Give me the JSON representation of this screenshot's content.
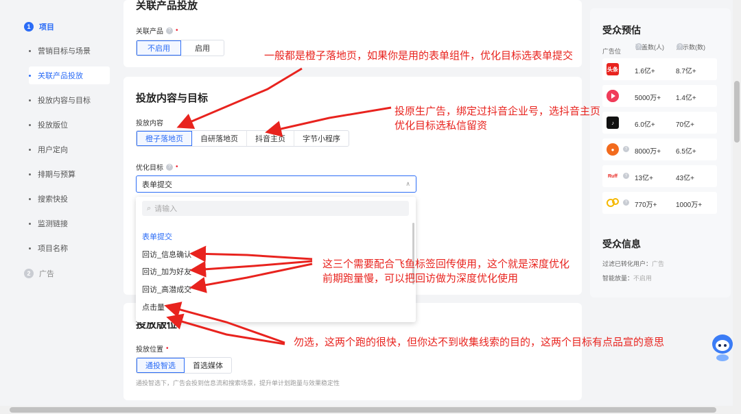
{
  "nav": {
    "steps": [
      {
        "num": "1",
        "label": "项目"
      },
      {
        "num": "2",
        "label": "广告"
      }
    ],
    "items": [
      {
        "label": "营销目标与场景"
      },
      {
        "label": "关联产品投放"
      },
      {
        "label": "投放内容与目标"
      },
      {
        "label": "投放版位"
      },
      {
        "label": "用户定向"
      },
      {
        "label": "排期与预算"
      },
      {
        "label": "搜索快投"
      },
      {
        "label": "监测链接"
      },
      {
        "label": "项目名称"
      }
    ]
  },
  "related": {
    "title": "关联产品投放",
    "label": "关联产品",
    "options": [
      "不启用",
      "启用"
    ]
  },
  "content": {
    "title": "投放内容与目标",
    "content_label": "投放内容",
    "content_options": [
      "橙子落地页",
      "自研落地页",
      "抖音主页",
      "字节小程序"
    ],
    "goal_label": "优化目标",
    "goal_value": "表单提交"
  },
  "dropdown": {
    "placeholder": "请输入",
    "items": [
      "表单提交",
      "回访_信息确认",
      "回访_加为好友",
      "回访_高潜成交",
      "点击量"
    ]
  },
  "placement": {
    "title": "投放版位",
    "label": "投放位置",
    "options": [
      "通投智选",
      "首选媒体"
    ],
    "hint": "通投智选下，广告会投到信息流和搜索场景，提升单计划跑量与效果稳定性"
  },
  "audience": {
    "title": "受众预估",
    "col_position": "广告位",
    "col_coverage": "覆盖数(人)",
    "col_impressions": "展示数(数)",
    "rows": [
      {
        "logo": "头条",
        "coverage": "1.6亿+",
        "impressions": "8.7亿+"
      },
      {
        "logo": "西瓜",
        "coverage": "5000万+",
        "impressions": "1.4亿+"
      },
      {
        "logo": "抖音",
        "coverage": "6.0亿+",
        "impressions": "70亿+"
      },
      {
        "logo": "番茄",
        "coverage": "8000万+",
        "impressions": "6.5亿+"
      },
      {
        "logo": "Ruff",
        "coverage": "13亿+",
        "impressions": "43亿+"
      },
      {
        "logo": "金币",
        "coverage": "770万+",
        "impressions": "1000万+"
      }
    ]
  },
  "audience_info": {
    "title": "受众信息",
    "filter_label": "过滤已转化用户：",
    "filter_value": "广告",
    "smart_label": "智能放量：",
    "smart_value": "不启用"
  },
  "annotations": {
    "a1": "一般都是橙子落地页，如果你是用的表单组件，优化目标选表单提交",
    "a2_line1": "投原生广告，绑定过抖音企业号，选抖音主页",
    "a2_line2": "优化目标选私信留资",
    "a3_line1": "这三个需要配合飞鱼标签回传使用，这个就是深度优化",
    "a3_line2": "前期跑量慢，可以把回访做为深度优化使用",
    "a4": "勿选，这两个跑的很快，但你达不到收集线索的目的，这两个目标有点品宣的意思"
  },
  "colors": {
    "accent": "#2b6cf6",
    "annotation": "#e8231e"
  }
}
